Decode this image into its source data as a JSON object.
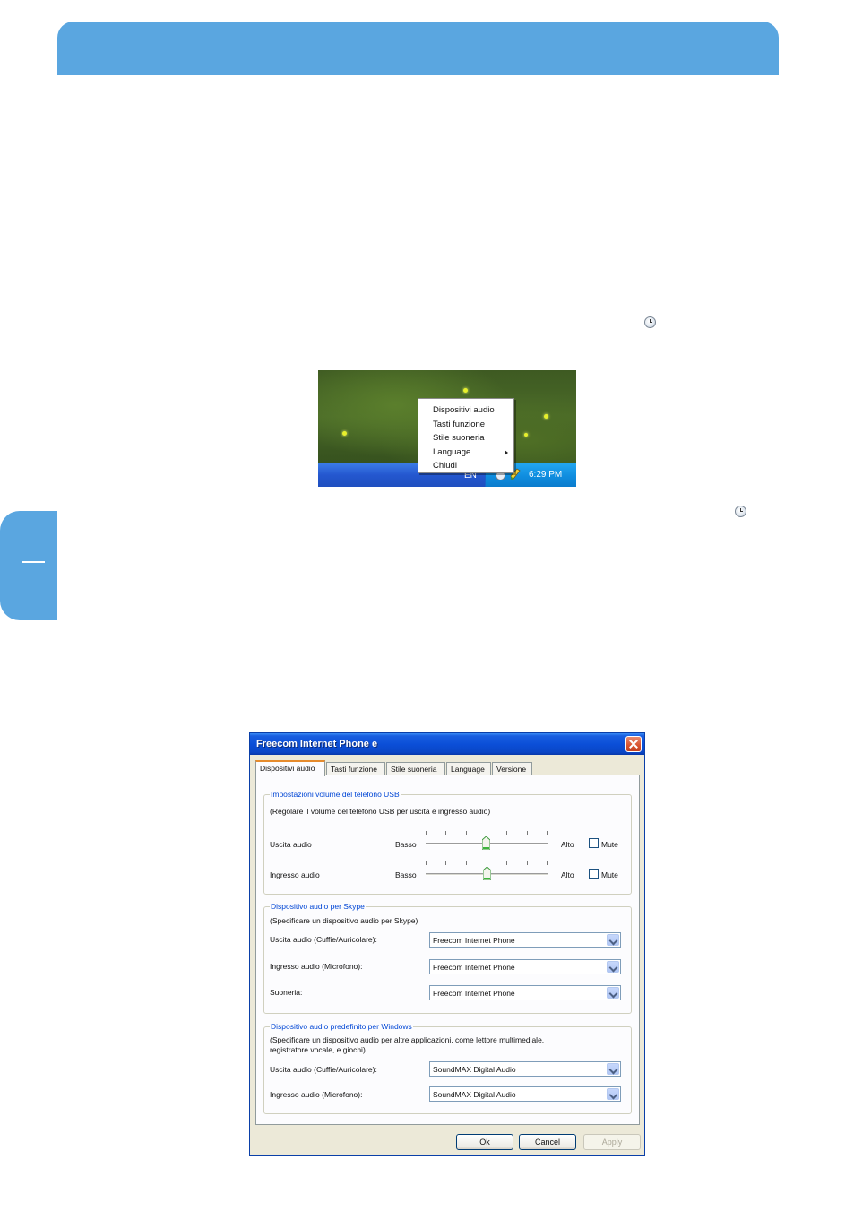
{
  "tray_menu": {
    "items": [
      {
        "label": "Dispositivi audio"
      },
      {
        "label": "Tasti funzione"
      },
      {
        "label": "Stile suoneria"
      },
      {
        "label": "Language"
      },
      {
        "label": "Chiudi"
      }
    ],
    "language_indicator": "EN",
    "clock_time": "6:29 PM"
  },
  "dialog": {
    "title": "Freecom Internet Phone e",
    "tabs": [
      {
        "label": "Dispositivi audio",
        "active": true
      },
      {
        "label": "Tasti funzione"
      },
      {
        "label": "Stile suoneria"
      },
      {
        "label": "Language"
      },
      {
        "label": "Versione"
      }
    ],
    "usb_group": {
      "title": "Impostazioni volume del telefono USB",
      "description": "(Regolare il volume del telefono USB per uscita e ingresso audio)",
      "rows": [
        {
          "label": "Uscita audio",
          "low": "Basso",
          "high": "Alto",
          "mute_label": "Mute",
          "muted": false,
          "level": 0.5
        },
        {
          "label": "Ingresso audio",
          "low": "Basso",
          "high": "Alto",
          "mute_label": "Mute",
          "muted": false,
          "level": 0.5
        }
      ]
    },
    "skype_group": {
      "title": "Dispositivo audio per Skype",
      "description": "(Specificare un dispositivo audio per Skype)",
      "rows": [
        {
          "label": "Uscita audio (Cuffie/Auricolare):",
          "value": "Freecom Internet Phone"
        },
        {
          "label": "Ingresso audio (Microfono):",
          "value": "Freecom Internet Phone"
        },
        {
          "label": "Suoneria:",
          "value": "Freecom Internet Phone"
        }
      ]
    },
    "windows_group": {
      "title": "Dispositivo audio predefinito per Windows",
      "description_line1": "(Specificare un dispositivo audio per altre applicazioni, come lettore multimediale,",
      "description_line2": "registratore vocale, e giochi)",
      "rows": [
        {
          "label": "Uscita audio (Cuffie/Auricolare):",
          "value": "SoundMAX Digital Audio"
        },
        {
          "label": "Ingresso audio (Microfono):",
          "value": "SoundMAX Digital Audio"
        }
      ]
    },
    "buttons": {
      "ok": "Ok",
      "cancel": "Cancel",
      "apply": "Apply"
    }
  }
}
